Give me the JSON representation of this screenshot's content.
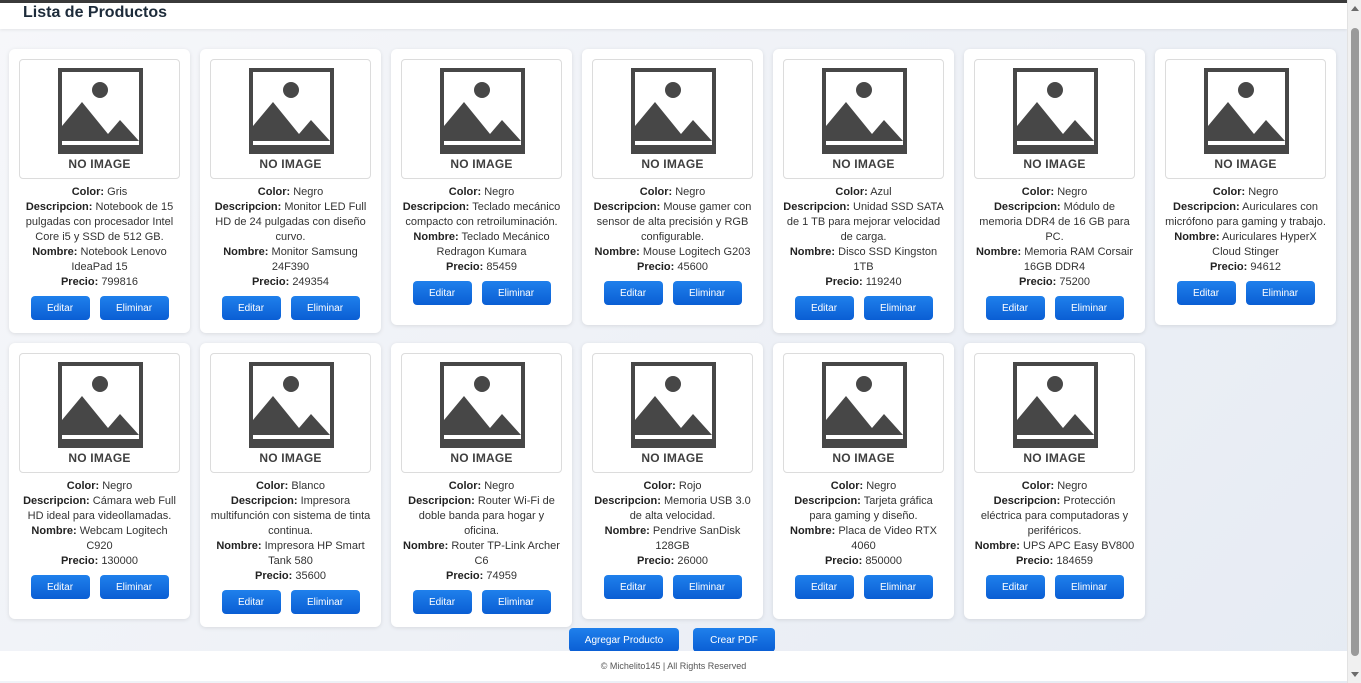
{
  "page": {
    "title": "Lista de Productos",
    "footer": "© Michelito145 | All Rights Reserved"
  },
  "labels": {
    "no_image": "NO IMAGE",
    "color": "Color:",
    "descripcion": "Descripcion:",
    "nombre": "Nombre:",
    "precio": "Precio:",
    "edit": "Editar",
    "delete": "Eliminar"
  },
  "actions": {
    "add": "Agregar Producto",
    "pdf": "Crear PDF"
  },
  "products": [
    {
      "color": "Gris",
      "descripcion": "Notebook de 15 pulgadas con procesador Intel Core i5 y SSD de 512 GB.",
      "nombre": "Notebook Lenovo IdeaPad 15",
      "precio": "799816"
    },
    {
      "color": "Negro",
      "descripcion": "Monitor LED Full HD de 24 pulgadas con diseño curvo.",
      "nombre": "Monitor Samsung 24F390",
      "precio": "249354"
    },
    {
      "color": "Negro",
      "descripcion": "Teclado mecánico compacto con retroiluminación.",
      "nombre": "Teclado Mecánico Redragon Kumara",
      "precio": "85459"
    },
    {
      "color": "Negro",
      "descripcion": "Mouse gamer con sensor de alta precisión y RGB configurable.",
      "nombre": "Mouse Logitech G203",
      "precio": "45600"
    },
    {
      "color": "Azul",
      "descripcion": "Unidad SSD SATA de 1 TB para mejorar velocidad de carga.",
      "nombre": "Disco SSD Kingston 1TB",
      "precio": "119240"
    },
    {
      "color": "Negro",
      "descripcion": "Módulo de memoria DDR4 de 16 GB para PC.",
      "nombre": "Memoria RAM Corsair 16GB DDR4",
      "precio": "75200"
    },
    {
      "color": "Negro",
      "descripcion": "Auriculares con micrófono para gaming y trabajo.",
      "nombre": "Auriculares HyperX Cloud Stinger",
      "precio": "94612"
    },
    {
      "color": "Negro",
      "descripcion": "Cámara web Full HD ideal para videollamadas.",
      "nombre": "Webcam Logitech C920",
      "precio": "130000"
    },
    {
      "color": "Blanco",
      "descripcion": "Impresora multifunción con sistema de tinta continua.",
      "nombre": "Impresora HP Smart Tank 580",
      "precio": "35600"
    },
    {
      "color": "Negro",
      "descripcion": "Router Wi-Fi de doble banda para hogar y oficina.",
      "nombre": "Router TP-Link Archer C6",
      "precio": "74959"
    },
    {
      "color": "Rojo",
      "descripcion": "Memoria USB 3.0 de alta velocidad.",
      "nombre": "Pendrive SanDisk 128GB",
      "precio": "26000"
    },
    {
      "color": "Negro",
      "descripcion": "Tarjeta gráfica para gaming y diseño.",
      "nombre": "Placa de Video RTX 4060",
      "precio": "850000"
    },
    {
      "color": "Negro",
      "descripcion": "Protección eléctrica para computadoras y periféricos.",
      "nombre": "UPS APC Easy BV800",
      "precio": "184659"
    }
  ],
  "colors": {
    "button": "#0a67e0",
    "placeholder": "#474747"
  }
}
